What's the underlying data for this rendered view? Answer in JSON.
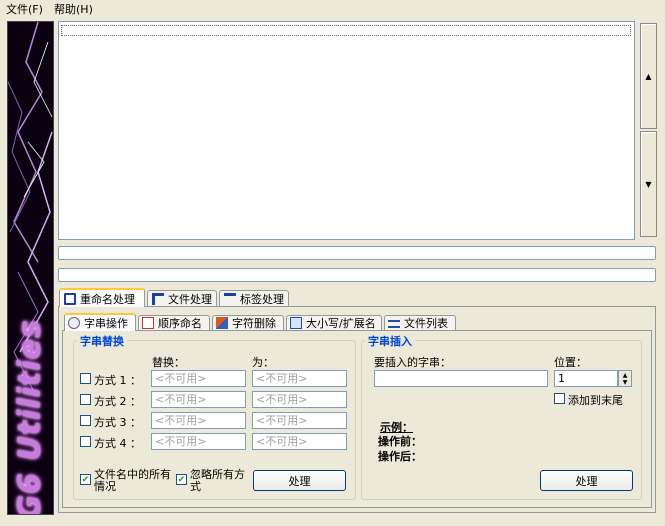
{
  "menu": {
    "file": "文件(F)",
    "help": "帮助(H)"
  },
  "banner": {
    "logo": "G6 Utilities"
  },
  "main_tabs": [
    "重命名处理",
    "文件处理",
    "标签处理"
  ],
  "sub_tabs": [
    "字串操作",
    "顺序命名",
    "字符删除",
    "大小写/扩展名",
    "文件列表"
  ],
  "replace_group": {
    "title": "字串替换",
    "col_replace": "替换：",
    "col_to": "为：",
    "rows": [
      {
        "label": "方式 1 ：",
        "from": "<不可用>",
        "to": "<不可用>"
      },
      {
        "label": "方式 2 ：",
        "from": "<不可用>",
        "to": "<不可用>"
      },
      {
        "label": "方式 3 ：",
        "from": "<不可用>",
        "to": "<不可用>"
      },
      {
        "label": "方式 4 ：",
        "from": "<不可用>",
        "to": "<不可用>"
      }
    ],
    "all_occurrences": "文件名中的所有情况",
    "ignore_case": "忽略所有方式",
    "process": "处理"
  },
  "insert_group": {
    "title": "字串插入",
    "string_label": "要插入的字串：",
    "position_label": "位置：",
    "position_value": "1",
    "append_end": "添加到末尾",
    "example": "示例：",
    "before": "操作前：",
    "after": "操作后：",
    "process": "处理"
  },
  "colors": {
    "accent": "#ffc83c",
    "border": "#7f9db9",
    "title": "#0046d5"
  }
}
